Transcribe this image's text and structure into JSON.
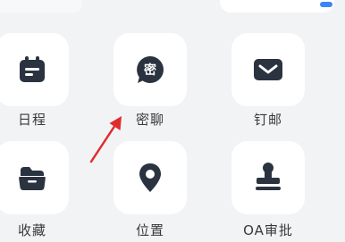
{
  "apps": [
    {
      "label": "日程",
      "icon": "calendar-icon"
    },
    {
      "label": "密聊",
      "icon": "secret-chat-icon",
      "badge_char": "密"
    },
    {
      "label": "钉邮",
      "icon": "mail-icon"
    },
    {
      "label": "收藏",
      "icon": "folder-icon"
    },
    {
      "label": "位置",
      "icon": "location-pin-icon"
    },
    {
      "label": "OA审批",
      "icon": "stamp-icon"
    }
  ],
  "annotation": {
    "type": "arrow",
    "color": "#e12b2b",
    "points_to": "密聊"
  },
  "colors": {
    "background": "#f2f3f5",
    "tile": "#ffffff",
    "icon": "#2b3340",
    "label": "#3a3a3a"
  }
}
